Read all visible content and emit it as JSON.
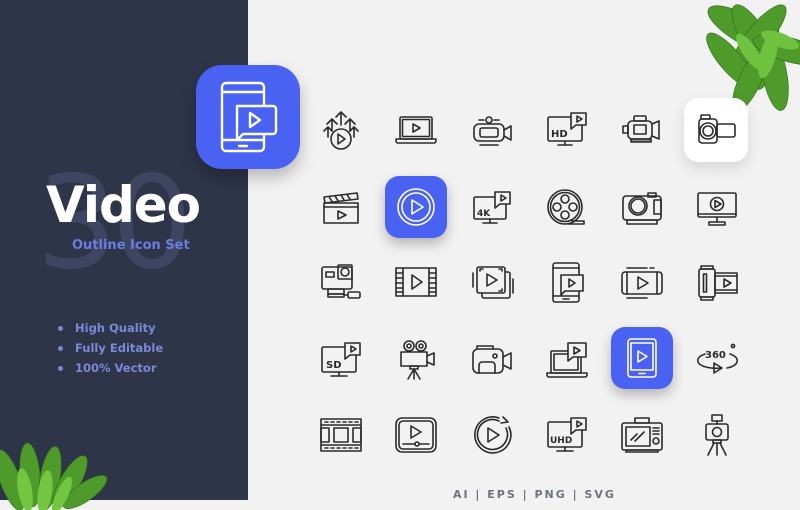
{
  "banner": {
    "count": "30",
    "title": "Video",
    "subtitle": "Outline Icon Set",
    "features": [
      "High Quality",
      "Fully Editable",
      "100% Vector"
    ],
    "formats": "AI | EPS | PNG | SVG",
    "hero_icon": "smartphone-video-message-icon"
  },
  "colors": {
    "left_panel": "#2e3549",
    "right_panel": "#f2f2f2",
    "accent": "#4a62f2",
    "subtitle": "#6b7de0",
    "icon_stroke": "#2b2b2b",
    "leaf_green": "#4caf2a"
  },
  "icons": [
    {
      "name": "upload-video-arrows-icon",
      "style": "outline"
    },
    {
      "name": "laptop-play-icon",
      "style": "outline"
    },
    {
      "name": "video-camera-icon",
      "style": "outline"
    },
    {
      "name": "hd-monitor-icon",
      "style": "outline"
    },
    {
      "name": "camcorder-icon",
      "style": "outline"
    },
    {
      "name": "handycam-icon",
      "style": "white-tile"
    },
    {
      "name": "clapperboard-icon",
      "style": "outline"
    },
    {
      "name": "play-circle-icon",
      "style": "blue-tile"
    },
    {
      "name": "4k-monitor-icon",
      "style": "outline"
    },
    {
      "name": "film-reel-icon",
      "style": "outline"
    },
    {
      "name": "photo-camera-icon",
      "style": "outline"
    },
    {
      "name": "monitor-play-icon",
      "style": "outline"
    },
    {
      "name": "action-camera-icon",
      "style": "outline"
    },
    {
      "name": "film-strip-play-icon",
      "style": "outline"
    },
    {
      "name": "video-playlist-icon",
      "style": "outline"
    },
    {
      "name": "phone-video-message-icon",
      "style": "outline"
    },
    {
      "name": "landscape-phone-play-icon",
      "style": "outline"
    },
    {
      "name": "film-roll-icon",
      "style": "outline"
    },
    {
      "name": "sd-monitor-icon",
      "style": "outline"
    },
    {
      "name": "movie-camera-tripod-icon",
      "style": "outline"
    },
    {
      "name": "video-recorder-icon",
      "style": "outline"
    },
    {
      "name": "laptop-video-message-icon",
      "style": "outline"
    },
    {
      "name": "tablet-play-icon",
      "style": "blue-tile"
    },
    {
      "name": "360-video-icon",
      "style": "outline"
    },
    {
      "name": "film-frames-icon",
      "style": "outline"
    },
    {
      "name": "video-player-icon",
      "style": "outline"
    },
    {
      "name": "replay-video-icon",
      "style": "outline"
    },
    {
      "name": "uhd-monitor-icon",
      "style": "outline"
    },
    {
      "name": "dslr-camera-back-icon",
      "style": "outline"
    },
    {
      "name": "camera-tripod-icon",
      "style": "outline"
    }
  ],
  "icon_text": {
    "hd": "HD",
    "4k": "4K",
    "sd": "SD",
    "uhd": "UHD",
    "360": "360"
  }
}
